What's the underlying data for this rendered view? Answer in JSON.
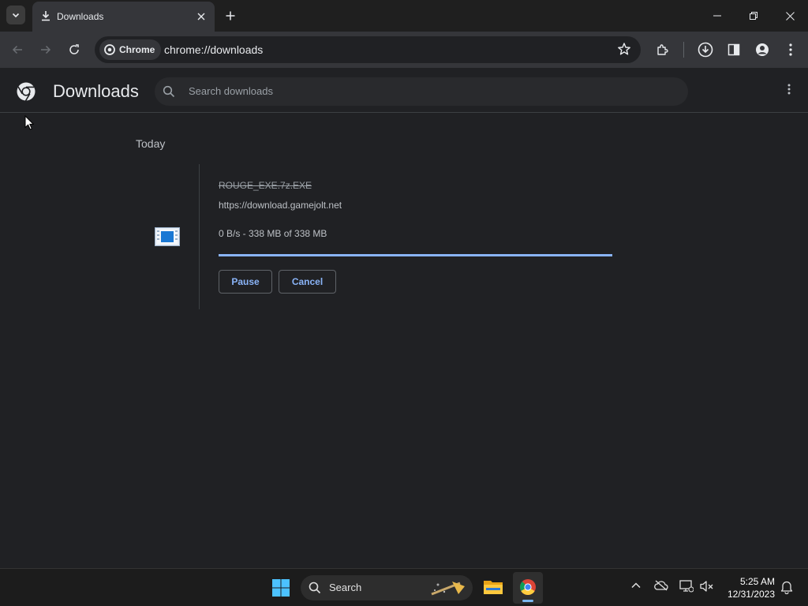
{
  "browser": {
    "tab_title": "Downloads",
    "site_chip": "Chrome",
    "url": "chrome://downloads"
  },
  "page": {
    "title": "Downloads",
    "search_placeholder": "Search downloads",
    "date_group": "Today"
  },
  "download": {
    "file_name": "ROUGE_EXE.7z.EXE",
    "source_url": "https://download.gamejolt.net",
    "status": "0 B/s - 338 MB of 338 MB",
    "progress_percent": 100,
    "pause_label": "Pause",
    "cancel_label": "Cancel"
  },
  "taskbar": {
    "search_label": "Search",
    "time": "5:25 AM",
    "date": "12/31/2023"
  },
  "colors": {
    "accent": "#8ab4f8",
    "page_bg": "#202124",
    "toolbar_bg": "#35363a"
  },
  "icons": [
    "tab-search-icon",
    "download-icon",
    "close-icon",
    "plus-icon",
    "minimize-icon",
    "restore-icon",
    "back-icon",
    "forward-icon",
    "reload-icon",
    "chrome-icon",
    "star-icon",
    "extensions-icon",
    "download-indicator-icon",
    "side-panel-icon",
    "profile-icon",
    "more-icon",
    "search-icon",
    "file-icon",
    "windows-start-icon",
    "file-explorer-icon",
    "chevron-up-icon",
    "onedrive-icon",
    "network-icon",
    "volume-icon",
    "bell-icon",
    "cursor-icon"
  ]
}
